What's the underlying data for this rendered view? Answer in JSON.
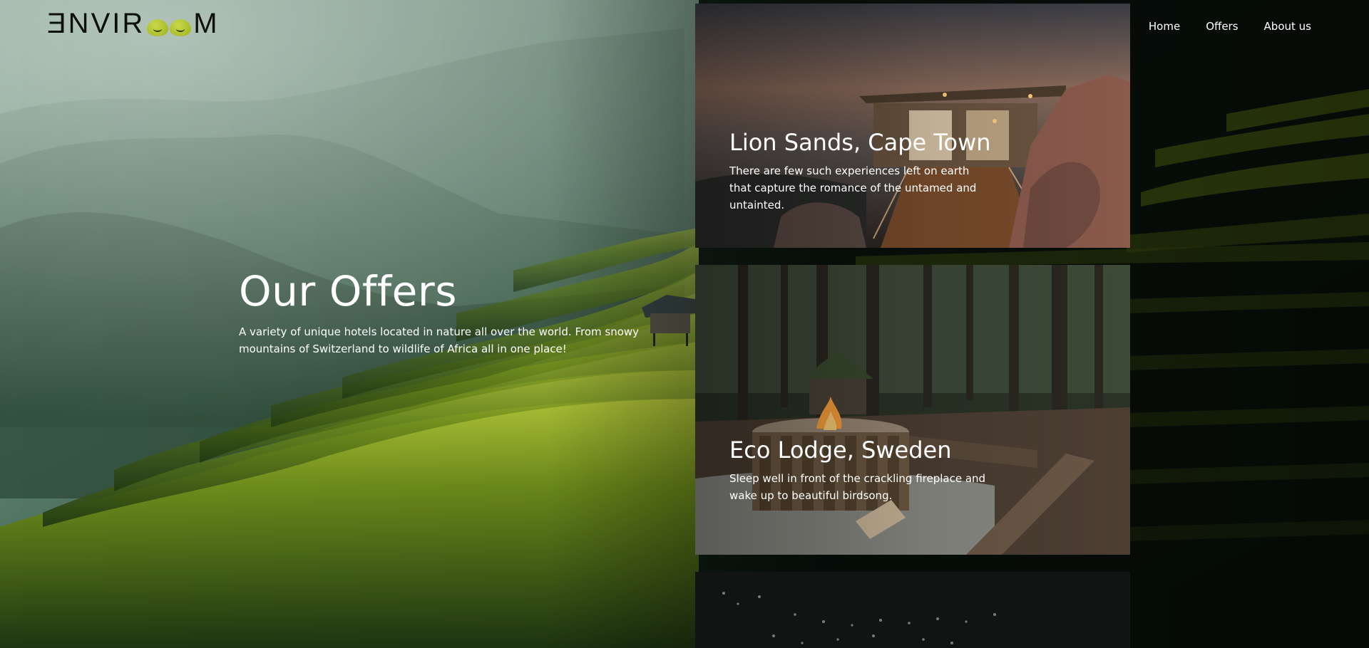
{
  "brand": {
    "logo_text": "ENVIROOM"
  },
  "nav": {
    "items": [
      {
        "label": "Home"
      },
      {
        "label": "Offers"
      },
      {
        "label": "About us"
      }
    ]
  },
  "hero": {
    "title": "Our Offers",
    "description": "A variety of unique hotels located in nature all over the world. From snowy mountains of Switzerland to wildlife of Africa all in one place!"
  },
  "offers": [
    {
      "title": "Lion Sands, Cape Town",
      "description": "There are few such experiences left on earth that capture the romance of the untamed and untainted."
    },
    {
      "title": "Eco Lodge, Sweden",
      "description": "Sleep well in front of the crackling fireplace and wake up to beautiful birdsong."
    },
    {
      "title": "",
      "description": ""
    }
  ],
  "colors": {
    "logo_accent": "#b3c72c",
    "text": "#ffffff",
    "terrace_green": "#7fa01e"
  }
}
